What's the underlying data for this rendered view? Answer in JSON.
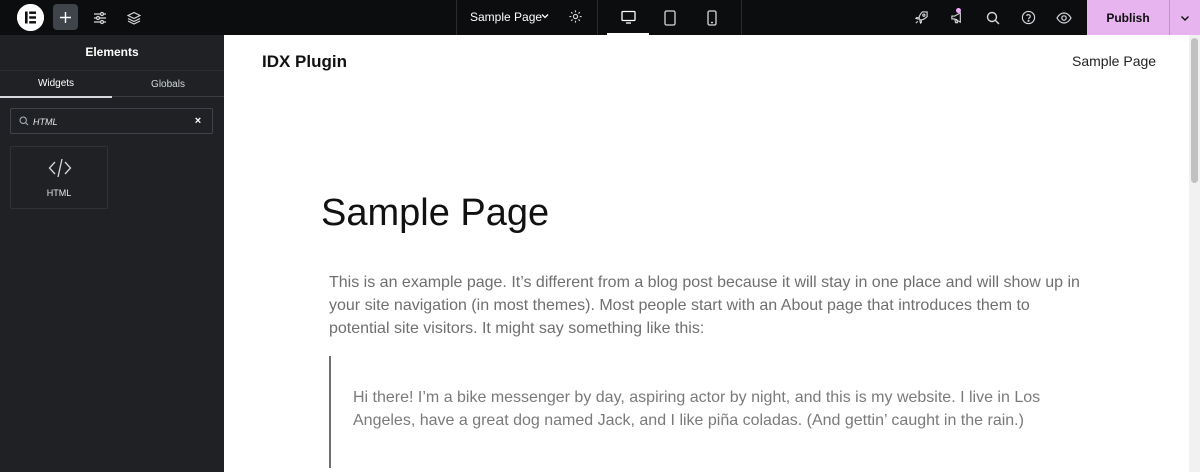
{
  "topbar": {
    "page_name": "Sample Page",
    "publish_label": "Publish"
  },
  "sidebar": {
    "title": "Elements",
    "tabs": [
      {
        "label": "Widgets",
        "active": true
      },
      {
        "label": "Globals",
        "active": false
      }
    ],
    "search": {
      "value": "HTML",
      "clear_symbol": "×"
    },
    "widgets": [
      {
        "label": "HTML",
        "icon": "code-icon"
      }
    ],
    "collapse_symbol": "‹"
  },
  "canvas": {
    "site_title": "IDX Plugin",
    "nav_item": "Sample Page",
    "page_heading": "Sample Page",
    "paragraph": "This is an example page. It’s different from a blog post because it will stay in one place and will show up in your site navigation (in most themes). Most people start with an About page that introduces them to potential site visitors. It might say something like this:",
    "quote": "Hi there! I’m a bike messenger by day, aspiring actor by night, and this is my website. I live in Los Angeles, have a great dog named Jack, and I like piña coladas. (And gettin’ caught in the rain.)"
  },
  "colors": {
    "topbar_bg": "#0c0d0e",
    "sidebar_bg": "#1f2124",
    "publish_bg": "#e8b4ef",
    "text_muted": "#6f6f6f"
  }
}
